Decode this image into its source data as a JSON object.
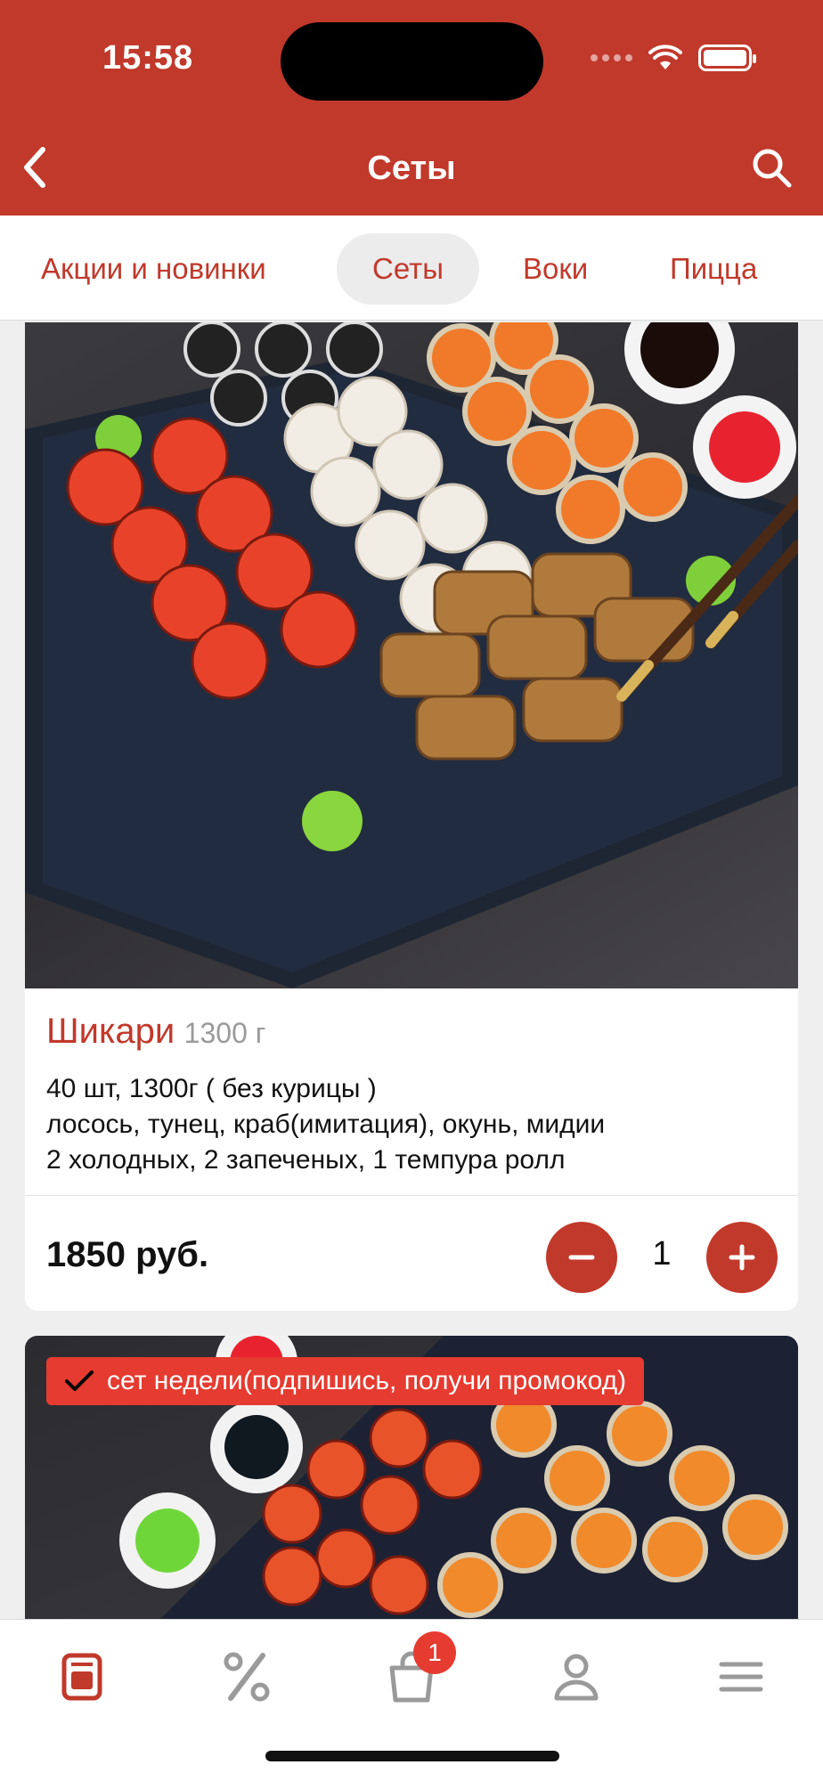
{
  "status": {
    "time": "15:58"
  },
  "nav": {
    "title": "Сеты",
    "back_icon": "chevron-left-icon",
    "search_icon": "search-icon"
  },
  "tabs": [
    {
      "label": "Акции и новинки",
      "active": false
    },
    {
      "label": "Сеты",
      "active": true
    },
    {
      "label": "Воки",
      "active": false
    },
    {
      "label": "Пицца",
      "active": false
    }
  ],
  "product": {
    "name": "Шикари",
    "weight": "1300 г",
    "description": [
      "40 шт, 1300г ( без курицы )",
      "лосось, тунец, краб(имитация), окунь, мидии",
      "2 холодных, 2 запеченых, 1 темпура ролл"
    ],
    "price": "1850 руб.",
    "quantity": "1"
  },
  "next_product": {
    "badge": "сет недели(подпишись, получи промокод)"
  },
  "tabbar": {
    "items": [
      "menu-icon",
      "discount-icon",
      "cart-icon",
      "profile-icon",
      "hamburger-icon"
    ],
    "cart_count": "1"
  },
  "colors": {
    "brand": "#c1392b",
    "badge": "#e53b30"
  }
}
